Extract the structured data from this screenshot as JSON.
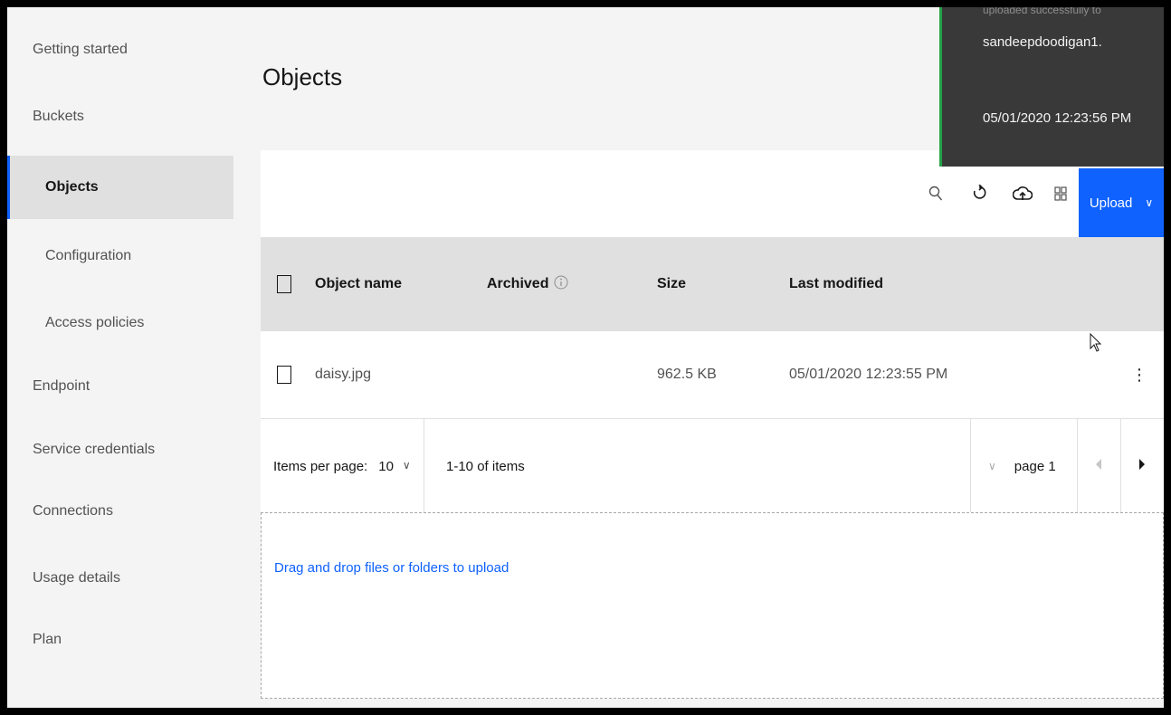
{
  "sidebar": {
    "items": [
      {
        "label": "Getting started"
      },
      {
        "label": "Buckets"
      },
      {
        "label": "Objects"
      },
      {
        "label": "Configuration"
      },
      {
        "label": "Access policies"
      },
      {
        "label": "Endpoint"
      },
      {
        "label": "Service credentials"
      },
      {
        "label": "Connections"
      },
      {
        "label": "Usage details"
      },
      {
        "label": "Plan"
      }
    ]
  },
  "header": {
    "title": "Objects"
  },
  "toast": {
    "clipped_text": "uploaded successfully to",
    "message": "sandeepdoodigan1.",
    "timestamp": "05/01/2020 12:23:56 PM",
    "accent_color": "#24a148"
  },
  "toolbar": {
    "icons": [
      "search-icon",
      "refresh-icon",
      "cloud-upload-icon",
      "grid-view-icon"
    ],
    "upload_label": "Upload",
    "upload_chevron": "∨",
    "accent_color": "#0f62fe"
  },
  "table": {
    "columns": {
      "name": "Object name",
      "archived": "Archived",
      "size": "Size",
      "modified": "Last modified"
    },
    "rows": [
      {
        "name": "daisy.jpg",
        "size": "962.5 KB",
        "modified": "05/01/2020 12:23:55 PM"
      }
    ]
  },
  "pagination": {
    "items_per_page_label": "Items per page:",
    "items_per_page_value": "10",
    "chevron": "∨",
    "range_text": "1-10 of items",
    "page_chevron": "∨",
    "page_label": "page 1"
  },
  "dropzone": {
    "text": "Drag and drop files or folders to upload"
  }
}
